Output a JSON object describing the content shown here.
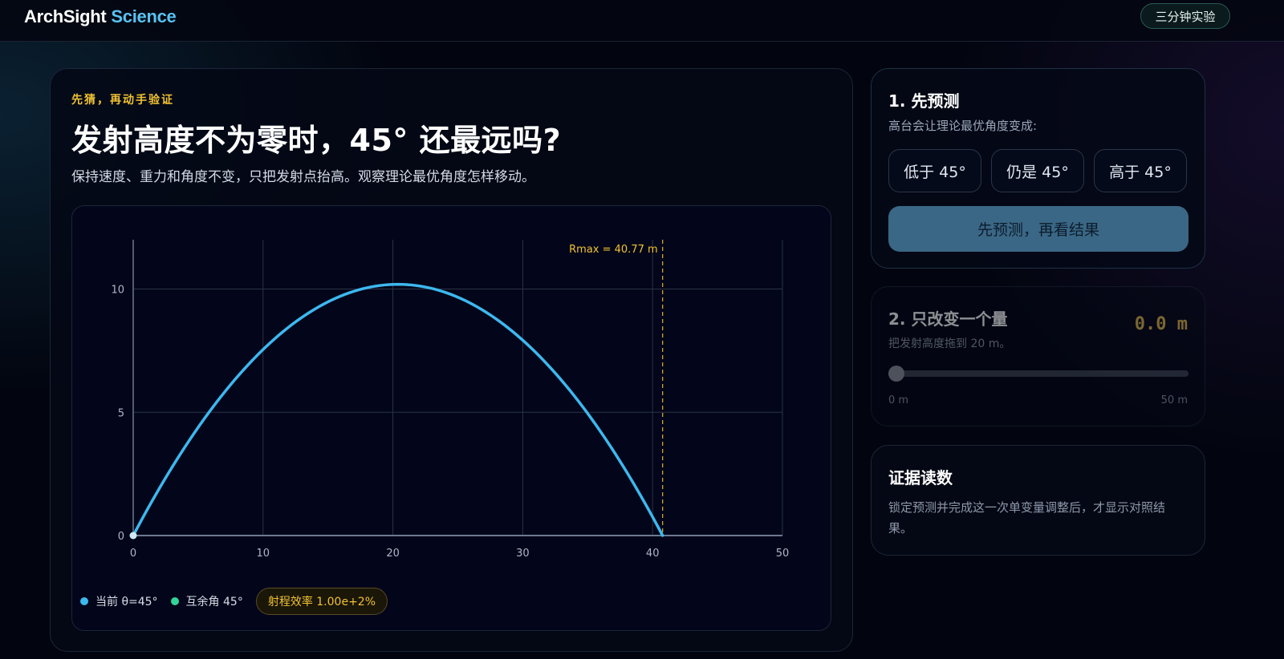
{
  "header": {
    "brand_name": "ArchSight",
    "brand_suffix": "Science",
    "lab_button": "三分钟实验"
  },
  "main": {
    "eyebrow": "先猜，再动手验证",
    "title": "发射高度不为零时，45° 还最远吗?",
    "subtitle": "保持速度、重力和角度不变，只把发射点抬高。观察理论最优角度怎样移动。"
  },
  "chart_data": {
    "type": "line",
    "series": [
      {
        "name": "当前 θ=45°",
        "color": "#3db8ef",
        "function": "trajectory",
        "launch_height": 0,
        "range": 40.77,
        "max_height": 10.19
      },
      {
        "name": "互余角 45°",
        "color": "#34d399"
      }
    ],
    "xlim": [
      0,
      50
    ],
    "ylim": [
      0,
      12
    ],
    "x_ticks": [
      0,
      10,
      20,
      30,
      40,
      50
    ],
    "y_ticks": [
      0,
      5,
      10
    ],
    "grid": true,
    "annotation": {
      "label": "Rmax = 40.77 m",
      "x": 40.77,
      "color": "#f1c232"
    },
    "badge": "射程效率 1.00e+2%"
  },
  "predict": {
    "heading": "1. 先预测",
    "question": "高台会让理论最优角度变成:",
    "options": [
      "低于 45°",
      "仍是 45°",
      "高于 45°"
    ],
    "button": "先预测，再看结果"
  },
  "control": {
    "heading": "2. 只改变一个量",
    "value": "0.0 m",
    "hint": "把发射高度拖到 20 m。",
    "slider_value": 0,
    "min_label": "0 m",
    "max_label": "50 m"
  },
  "evidence": {
    "heading": "证据读数",
    "text": "锁定预测并完成这一次单变量调整后，才显示对照结果。"
  }
}
